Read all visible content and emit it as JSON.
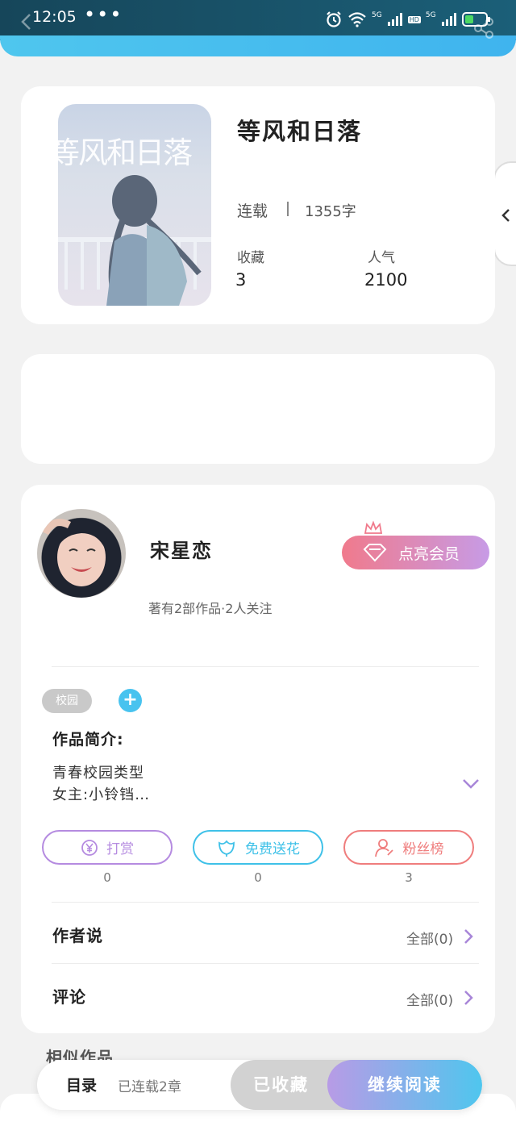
{
  "status_bar": {
    "time": "12:05",
    "more": "•••",
    "net1": "5G",
    "hd": "HD",
    "net2": "5G"
  },
  "book": {
    "cover_title": "等风和日落",
    "title": "等风和日落",
    "status": "连载",
    "word_count": "1355字",
    "favorites_label": "收藏",
    "favorites_value": "3",
    "popularity_label": "人气",
    "popularity_value": "2100"
  },
  "author": {
    "name": "宋星恋",
    "meta": "著有2部作品·2人关注",
    "vip_button": "点亮会员"
  },
  "work": {
    "tag": "校园",
    "intro_heading": "作品简介:",
    "intro_line1": "青春校园类型",
    "intro_line2": "女主:小铃铛…"
  },
  "actions": [
    {
      "label": "打赏",
      "count": "0",
      "color": "#b58be0"
    },
    {
      "label": "免费送花",
      "count": "0",
      "color": "#3fc1e8"
    },
    {
      "label": "粉丝榜",
      "count": "3",
      "color": "#ef7d7d"
    }
  ],
  "rows": {
    "author_says": {
      "title": "作者说",
      "all": "全部(0)"
    },
    "comments": {
      "title": "评论",
      "all": "全部(0)"
    }
  },
  "similar_works": "相似作品",
  "bottom_bar": {
    "toc": "目录",
    "toc_status": "已连载2章",
    "collected": "已收藏",
    "continue": "继续阅读"
  },
  "colors": {
    "accent_blue": "#48c3ef",
    "vip_pink": "#f07a8c",
    "vip_purple": "#c79be6"
  }
}
